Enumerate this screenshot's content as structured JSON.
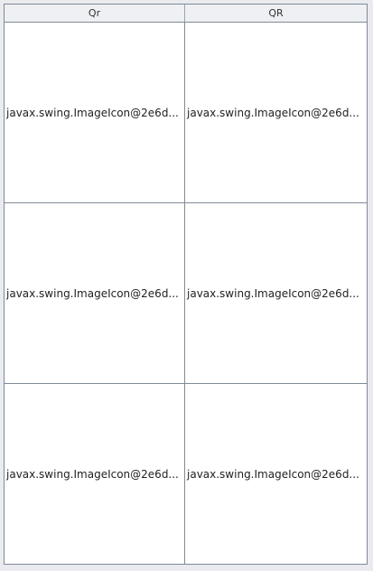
{
  "table": {
    "columns": [
      "Qr",
      "QR"
    ],
    "rows": [
      [
        "javax.swing.ImageIcon@2e6d...",
        "javax.swing.ImageIcon@2e6d..."
      ],
      [
        "javax.swing.ImageIcon@2e6d...",
        "javax.swing.ImageIcon@2e6d..."
      ],
      [
        "javax.swing.ImageIcon@2e6d...",
        "javax.swing.ImageIcon@2e6d..."
      ]
    ]
  }
}
